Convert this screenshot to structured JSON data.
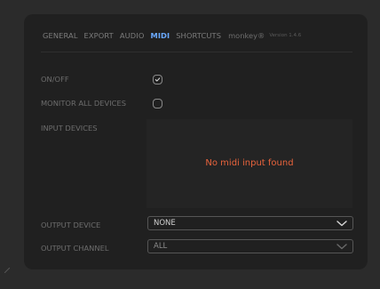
{
  "tabs": [
    {
      "label": "GENERAL"
    },
    {
      "label": "EXPORT"
    },
    {
      "label": "AUDIO"
    },
    {
      "label": "MIDI"
    },
    {
      "label": "SHORTCUTS"
    }
  ],
  "brand": "monkey®",
  "version": "Version 1.4.6",
  "settings": {
    "on_off_label": "ON/OFF",
    "on_off_checked": true,
    "monitor_label": "MONITOR ALL DEVICES",
    "monitor_checked": false,
    "input_devices_label": "INPUT DEVICES",
    "no_input_message": "No midi input found",
    "output_device_label": "OUTPUT DEVICE",
    "output_device_value": "NONE",
    "output_channel_label": "OUTPUT CHANNEL",
    "output_channel_value": "ALL"
  },
  "colors": {
    "active_tab": "#6aa9ff",
    "warning_text": "#e8633c",
    "panel": "#202020"
  },
  "icons": {
    "check": "checkmark-icon",
    "chevron": "chevron-down-icon"
  }
}
